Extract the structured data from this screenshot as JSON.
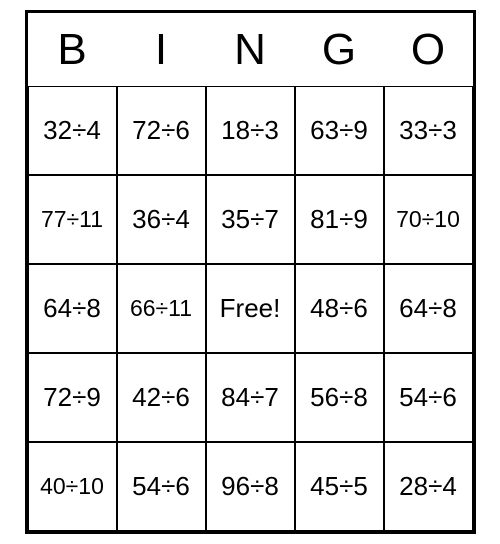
{
  "header": [
    "B",
    "I",
    "N",
    "G",
    "O"
  ],
  "grid": [
    [
      "32÷4",
      "72÷6",
      "18÷3",
      "63÷9",
      "33÷3"
    ],
    [
      "77÷11",
      "36÷4",
      "35÷7",
      "81÷9",
      "70÷10"
    ],
    [
      "64÷8",
      "66÷11",
      "Free!",
      "48÷6",
      "64÷8"
    ],
    [
      "72÷9",
      "42÷6",
      "84÷7",
      "56÷8",
      "54÷6"
    ],
    [
      "40÷10",
      "54÷6",
      "96÷8",
      "45÷5",
      "28÷4"
    ]
  ]
}
